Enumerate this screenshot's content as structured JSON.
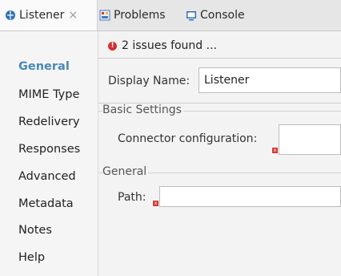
{
  "tabs": {
    "listener": {
      "label": "Listener",
      "close": "×",
      "icon": "globe-icon"
    },
    "problems": {
      "label": "Problems",
      "icon": "problems-icon"
    },
    "console": {
      "label": "Console",
      "icon": "console-icon"
    }
  },
  "sidebar": {
    "items": [
      {
        "label": "General",
        "active": true
      },
      {
        "label": "MIME Type"
      },
      {
        "label": "Redelivery"
      },
      {
        "label": "Responses"
      },
      {
        "label": "Advanced"
      },
      {
        "label": "Metadata"
      },
      {
        "label": "Notes"
      },
      {
        "label": "Help"
      }
    ]
  },
  "main": {
    "issues": {
      "text": "2 issues found ...",
      "icon": "error-icon"
    },
    "display_name": {
      "label": "Display Name:",
      "value": "Listener"
    },
    "basic_settings": {
      "title": "Basic Settings",
      "connector_label": "Connector configuration:",
      "connector_value": ""
    },
    "general": {
      "title": "General",
      "path_label": "Path:",
      "path_value": ""
    }
  },
  "colors": {
    "active_nav": "#4a88b5",
    "error": "#d32f2f",
    "tab_icon": "#2f6fb6"
  }
}
